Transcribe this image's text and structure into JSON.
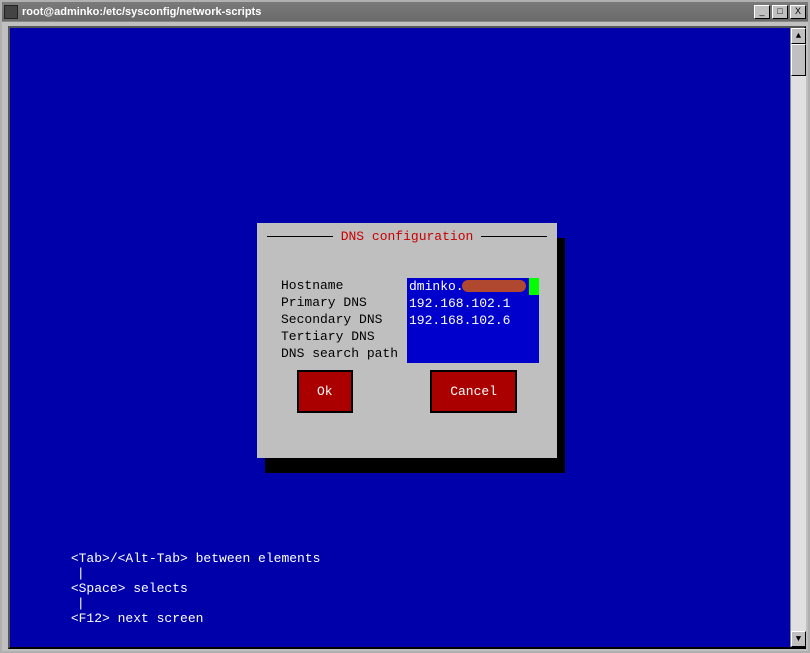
{
  "window": {
    "title": "root@adminko:/etc/sysconfig/network-scripts",
    "controls": {
      "minimize": "_",
      "maximize": "□",
      "close": "X"
    }
  },
  "dialog": {
    "title": "DNS configuration",
    "fields": {
      "hostname": {
        "label": "Hostname",
        "value": "dminko."
      },
      "primary_dns": {
        "label": "Primary DNS",
        "value": "192.168.102.1"
      },
      "secondary_dns": {
        "label": "Secondary DNS",
        "value": "192.168.102.6"
      },
      "tertiary_dns": {
        "label": "Tertiary DNS",
        "value": ""
      },
      "dns_search_path": {
        "label": "DNS search path",
        "value": ""
      }
    },
    "buttons": {
      "ok": "Ok",
      "cancel": "Cancel"
    }
  },
  "footer": {
    "hint1": "<Tab>/<Alt-Tab> between elements",
    "hint2": "<Space> selects",
    "hint3": "<F12> next screen",
    "sep": "|"
  }
}
